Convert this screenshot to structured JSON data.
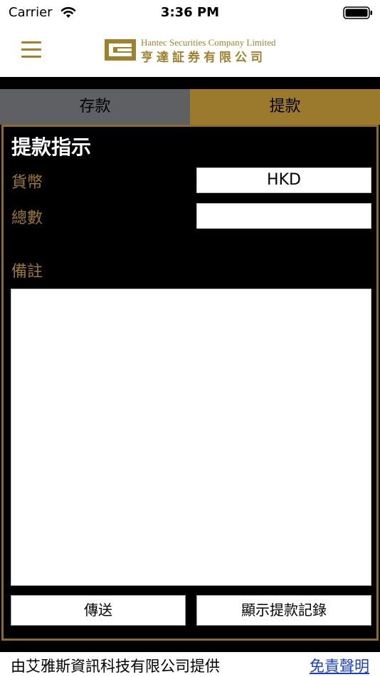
{
  "status_bar": {
    "carrier": "Carrier",
    "time": "3:36 PM"
  },
  "header": {
    "logo_en": "Hantec Securities Company Limited",
    "logo_cn": "亨達証券有限公司",
    "brand_color": "#a0822e"
  },
  "tabs": [
    {
      "label": "存款",
      "active": false
    },
    {
      "label": "提款",
      "active": true
    }
  ],
  "form": {
    "title": "提款指示",
    "currency_label": "貨幣",
    "currency_value": "HKD",
    "amount_label": "總數",
    "amount_value": "",
    "remark_label": "備註",
    "remark_value": ""
  },
  "buttons": {
    "send": "傳送",
    "history": "顯示提款記錄"
  },
  "footer": {
    "provider_text": "由艾雅斯資訊科技有限公司提供",
    "disclaimer_link": "免責聲明"
  },
  "colors": {
    "gold": "#9b7a2d",
    "tab_inactive": "#5f6064",
    "link": "#1a3ecf"
  }
}
